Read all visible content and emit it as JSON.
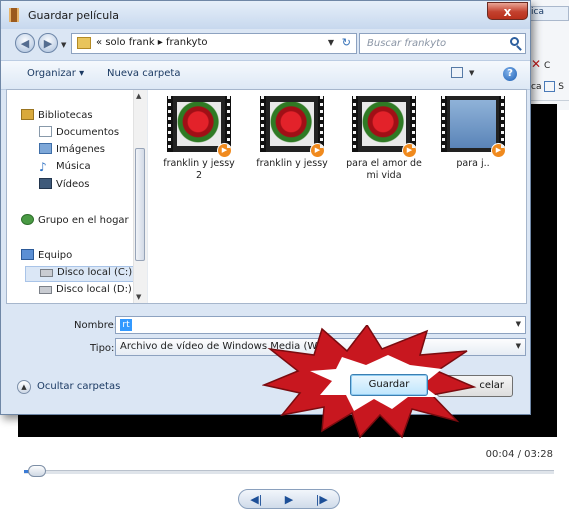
{
  "background_app": {
    "tab_fragment": "ica",
    "tool_fragment_1": "C",
    "tool_fragment_2": "ca",
    "tool_fragment_3": "S",
    "time_display": "00:04 / 03:28",
    "progress_fraction": 0.02,
    "player_icons": [
      "previous-frame-icon",
      "play-icon",
      "next-frame-icon"
    ]
  },
  "dialog": {
    "title": "Guardar película",
    "close_label": "x",
    "address": {
      "root_marker": "«",
      "crumb_1": "solo frank",
      "sep": "▸",
      "crumb_2": "frankyto"
    },
    "search_placeholder": "Buscar frankyto",
    "toolbar": {
      "organize": "Organizar ▾",
      "new_folder": "Nueva carpeta",
      "help": "?"
    },
    "sidebar": {
      "libraries": "Bibliotecas",
      "documents": "Documentos",
      "images": "Imágenes",
      "music": "Música",
      "videos": "Vídeos",
      "homegroup": "Grupo en el hogar",
      "computer": "Equipo",
      "drive_c": "Disco local (C:)",
      "drive_d": "Disco local (D:)"
    },
    "files": [
      {
        "name": "franklin y jessy 2"
      },
      {
        "name": "franklin y jessy"
      },
      {
        "name": "para el amor de mi vida"
      },
      {
        "name": "para j.."
      }
    ],
    "name_label": "Nombre:",
    "name_value": "rt",
    "type_label": "Tipo:",
    "type_value": "Archivo de vídeo de Windows Media (WMV)",
    "hide_folders": "Ocultar carpetas",
    "save_button": "Guardar",
    "cancel_button_fragment": "celar"
  }
}
